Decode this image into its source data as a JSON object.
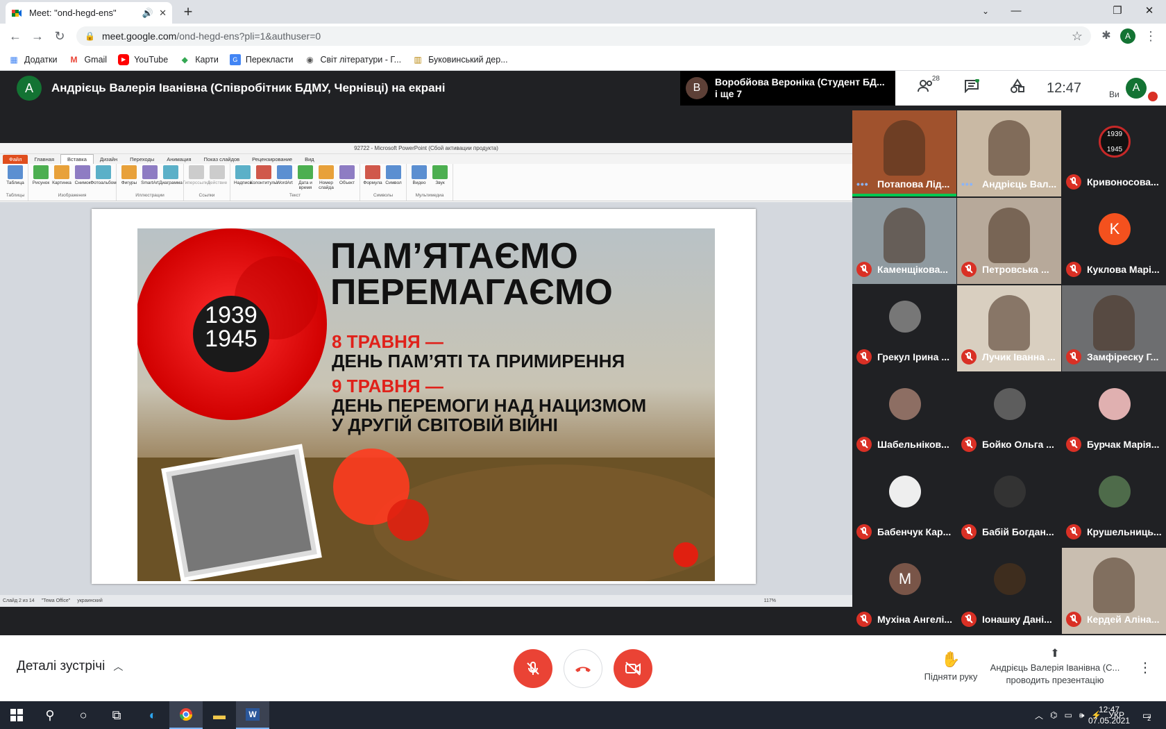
{
  "browser": {
    "tab_title": "Meet: \"ond-hegd-ens\"",
    "url_host": "meet.google.com",
    "url_path": "/ond-hegd-ens?pli=1&authuser=0",
    "profile_initial": "A",
    "bookmarks": [
      {
        "label": "Додатки",
        "icon": "apps-grid-icon"
      },
      {
        "label": "Gmail",
        "icon": "gmail-icon"
      },
      {
        "label": "YouTube",
        "icon": "youtube-icon"
      },
      {
        "label": "Карти",
        "icon": "maps-icon"
      },
      {
        "label": "Перекласти",
        "icon": "translate-icon"
      },
      {
        "label": "Світ літератури - Г...",
        "icon": "globe-icon"
      },
      {
        "label": "Буковинський дер...",
        "icon": "bookmark-icon"
      }
    ]
  },
  "meet": {
    "presenter_initial": "A",
    "presenter_label": "Андрієць Валерія Іванівна (Співробітник БДМУ, Чернівці) на екрані",
    "speaking_initial": "B",
    "speaking_line1": "Воробйова Вероніка (Студент БД...",
    "speaking_line2": "і ще 7",
    "participants_count": "28",
    "time": "12:47",
    "you_label": "Ви",
    "self_initial": "A",
    "tiles": [
      {
        "name": "Потапова Лід...",
        "state": "talking",
        "kind": "video",
        "bg": "#a0522d"
      },
      {
        "name": "Андрієць Вал...",
        "state": "talking",
        "kind": "video",
        "bg": "#c9b9a4"
      },
      {
        "name": "Кривоносова...",
        "state": "muted",
        "kind": "avatar-logo",
        "bg": "#202124"
      },
      {
        "name": "Каменщікова...",
        "state": "muted",
        "kind": "video",
        "bg": "#8f9aa0"
      },
      {
        "name": "Петровська ...",
        "state": "muted",
        "kind": "video",
        "bg": "#b7a99a"
      },
      {
        "name": "Куклова Марі...",
        "state": "muted",
        "kind": "letter",
        "letter": "K",
        "bg": "#202124",
        "color": "#f4511e"
      },
      {
        "name": "Грекул Ірина ...",
        "state": "muted",
        "kind": "avatar",
        "bg": "#202124",
        "color": "#777"
      },
      {
        "name": "Лучик Іванна ...",
        "state": "muted",
        "kind": "video",
        "bg": "#d9cfc0"
      },
      {
        "name": "Замфіреску Г...",
        "state": "muted",
        "kind": "video",
        "bg": "#6d6e70"
      },
      {
        "name": "Шабельніков...",
        "state": "muted",
        "kind": "avatar",
        "bg": "#202124",
        "color": "#8d6e63"
      },
      {
        "name": "Бойко Ольга ...",
        "state": "muted",
        "kind": "avatar",
        "bg": "#202124",
        "color": "#5d5d5d"
      },
      {
        "name": "Бурчак Марія...",
        "state": "muted",
        "kind": "avatar",
        "bg": "#202124",
        "color": "#e0b0b0"
      },
      {
        "name": "Бабенчук Кар...",
        "state": "muted",
        "kind": "avatar",
        "bg": "#202124",
        "color": "#eeeeee"
      },
      {
        "name": "Бабій Богдан...",
        "state": "muted",
        "kind": "avatar",
        "bg": "#202124",
        "color": "#333333"
      },
      {
        "name": "Крушельниць...",
        "state": "muted",
        "kind": "avatar",
        "bg": "#202124",
        "color": "#4e6b4a"
      },
      {
        "name": "Мухіна Ангелі...",
        "state": "muted",
        "kind": "letter",
        "letter": "M",
        "bg": "#202124",
        "color": "#795548"
      },
      {
        "name": "Іонашку Дані...",
        "state": "muted",
        "kind": "avatar",
        "bg": "#202124",
        "color": "#3e2d1e"
      },
      {
        "name": "Кердей Аліна...",
        "state": "muted",
        "kind": "video",
        "bg": "#c9beb0"
      }
    ],
    "details_label": "Деталі зустрічі",
    "raise_hand_label": "Підняти руку",
    "presenting_label": "Андрієць Валерія Іванівна (С... проводить презентацію",
    "colors": {
      "red": "#ea4335",
      "dark": "#202124"
    }
  },
  "ppt": {
    "window_title": "92722 - Microsoft PowerPoint (Сбой активации продукта)",
    "tabs": [
      "Файл",
      "Главная",
      "Вставка",
      "Дизайн",
      "Переходы",
      "Анимация",
      "Показ слайдов",
      "Рецензирование",
      "Вид"
    ],
    "active_tab": "Вставка",
    "groups": [
      {
        "label": "Таблицы",
        "items": [
          "Таблица"
        ]
      },
      {
        "label": "Изображения",
        "items": [
          "Рисунок",
          "Картинка",
          "Снимок",
          "Фотоальбом"
        ]
      },
      {
        "label": "Иллюстрации",
        "items": [
          "Фигуры",
          "SmartArt",
          "Диаграмма"
        ]
      },
      {
        "label": "Ссылки",
        "items": [
          "Гиперссылка",
          "Действие"
        ]
      },
      {
        "label": "Текст",
        "items": [
          "Надпись",
          "Колонтитулы",
          "WordArt",
          "Дата и время",
          "Номер слайда",
          "Объект"
        ]
      },
      {
        "label": "Символы",
        "items": [
          "Формула",
          "Символ"
        ]
      },
      {
        "label": "Мультимедиа",
        "items": [
          "Видео",
          "Звук"
        ]
      }
    ],
    "status_slide": "Слайд 2 из 14",
    "status_theme": "\"Тема Office\"",
    "status_lang": "украинский",
    "zoom": "117%"
  },
  "slide": {
    "years_top": "1939",
    "years_bottom": "1945",
    "headline1": "ПАМ’ЯТАЄМО",
    "headline2": "ПЕРЕМАГАЄМО",
    "date1": "8 ТРАВНЯ —",
    "line1": "ДЕНЬ ПАМ’ЯТІ ТА ПРИМИРЕННЯ",
    "date2": "9 ТРАВНЯ —",
    "line2": "ДЕНЬ ПЕРЕМОГИ НАД НАЦИЗМОМ",
    "line3": "У ДРУГІЙ СВІТОВІЙ ВІЙНІ"
  },
  "taskbar": {
    "lang": "УКР",
    "time": "12:47",
    "date": "07.05.2021",
    "notif_count": "2"
  }
}
